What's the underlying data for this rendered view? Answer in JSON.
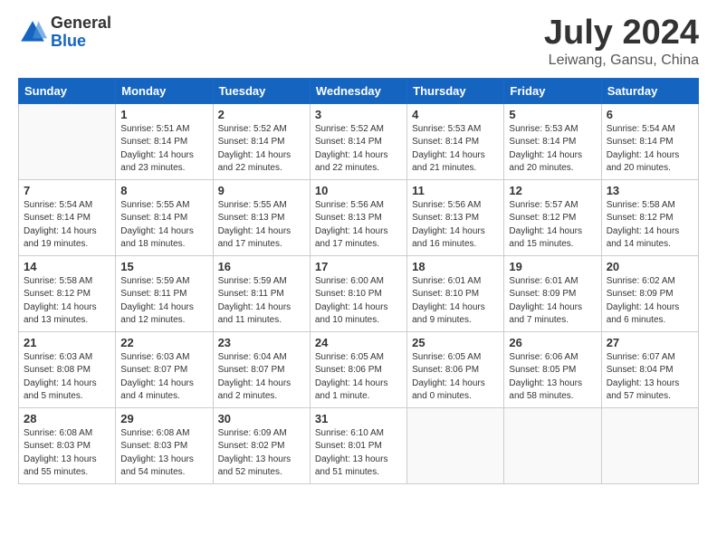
{
  "header": {
    "logo_general": "General",
    "logo_blue": "Blue",
    "month": "July 2024",
    "location": "Leiwang, Gansu, China"
  },
  "weekdays": [
    "Sunday",
    "Monday",
    "Tuesday",
    "Wednesday",
    "Thursday",
    "Friday",
    "Saturday"
  ],
  "weeks": [
    [
      {
        "day": "",
        "info": ""
      },
      {
        "day": "1",
        "info": "Sunrise: 5:51 AM\nSunset: 8:14 PM\nDaylight: 14 hours\nand 23 minutes."
      },
      {
        "day": "2",
        "info": "Sunrise: 5:52 AM\nSunset: 8:14 PM\nDaylight: 14 hours\nand 22 minutes."
      },
      {
        "day": "3",
        "info": "Sunrise: 5:52 AM\nSunset: 8:14 PM\nDaylight: 14 hours\nand 22 minutes."
      },
      {
        "day": "4",
        "info": "Sunrise: 5:53 AM\nSunset: 8:14 PM\nDaylight: 14 hours\nand 21 minutes."
      },
      {
        "day": "5",
        "info": "Sunrise: 5:53 AM\nSunset: 8:14 PM\nDaylight: 14 hours\nand 20 minutes."
      },
      {
        "day": "6",
        "info": "Sunrise: 5:54 AM\nSunset: 8:14 PM\nDaylight: 14 hours\nand 20 minutes."
      }
    ],
    [
      {
        "day": "7",
        "info": "Sunrise: 5:54 AM\nSunset: 8:14 PM\nDaylight: 14 hours\nand 19 minutes."
      },
      {
        "day": "8",
        "info": "Sunrise: 5:55 AM\nSunset: 8:14 PM\nDaylight: 14 hours\nand 18 minutes."
      },
      {
        "day": "9",
        "info": "Sunrise: 5:55 AM\nSunset: 8:13 PM\nDaylight: 14 hours\nand 17 minutes."
      },
      {
        "day": "10",
        "info": "Sunrise: 5:56 AM\nSunset: 8:13 PM\nDaylight: 14 hours\nand 17 minutes."
      },
      {
        "day": "11",
        "info": "Sunrise: 5:56 AM\nSunset: 8:13 PM\nDaylight: 14 hours\nand 16 minutes."
      },
      {
        "day": "12",
        "info": "Sunrise: 5:57 AM\nSunset: 8:12 PM\nDaylight: 14 hours\nand 15 minutes."
      },
      {
        "day": "13",
        "info": "Sunrise: 5:58 AM\nSunset: 8:12 PM\nDaylight: 14 hours\nand 14 minutes."
      }
    ],
    [
      {
        "day": "14",
        "info": "Sunrise: 5:58 AM\nSunset: 8:12 PM\nDaylight: 14 hours\nand 13 minutes."
      },
      {
        "day": "15",
        "info": "Sunrise: 5:59 AM\nSunset: 8:11 PM\nDaylight: 14 hours\nand 12 minutes."
      },
      {
        "day": "16",
        "info": "Sunrise: 5:59 AM\nSunset: 8:11 PM\nDaylight: 14 hours\nand 11 minutes."
      },
      {
        "day": "17",
        "info": "Sunrise: 6:00 AM\nSunset: 8:10 PM\nDaylight: 14 hours\nand 10 minutes."
      },
      {
        "day": "18",
        "info": "Sunrise: 6:01 AM\nSunset: 8:10 PM\nDaylight: 14 hours\nand 9 minutes."
      },
      {
        "day": "19",
        "info": "Sunrise: 6:01 AM\nSunset: 8:09 PM\nDaylight: 14 hours\nand 7 minutes."
      },
      {
        "day": "20",
        "info": "Sunrise: 6:02 AM\nSunset: 8:09 PM\nDaylight: 14 hours\nand 6 minutes."
      }
    ],
    [
      {
        "day": "21",
        "info": "Sunrise: 6:03 AM\nSunset: 8:08 PM\nDaylight: 14 hours\nand 5 minutes."
      },
      {
        "day": "22",
        "info": "Sunrise: 6:03 AM\nSunset: 8:07 PM\nDaylight: 14 hours\nand 4 minutes."
      },
      {
        "day": "23",
        "info": "Sunrise: 6:04 AM\nSunset: 8:07 PM\nDaylight: 14 hours\nand 2 minutes."
      },
      {
        "day": "24",
        "info": "Sunrise: 6:05 AM\nSunset: 8:06 PM\nDaylight: 14 hours\nand 1 minute."
      },
      {
        "day": "25",
        "info": "Sunrise: 6:05 AM\nSunset: 8:06 PM\nDaylight: 14 hours\nand 0 minutes."
      },
      {
        "day": "26",
        "info": "Sunrise: 6:06 AM\nSunset: 8:05 PM\nDaylight: 13 hours\nand 58 minutes."
      },
      {
        "day": "27",
        "info": "Sunrise: 6:07 AM\nSunset: 8:04 PM\nDaylight: 13 hours\nand 57 minutes."
      }
    ],
    [
      {
        "day": "28",
        "info": "Sunrise: 6:08 AM\nSunset: 8:03 PM\nDaylight: 13 hours\nand 55 minutes."
      },
      {
        "day": "29",
        "info": "Sunrise: 6:08 AM\nSunset: 8:03 PM\nDaylight: 13 hours\nand 54 minutes."
      },
      {
        "day": "30",
        "info": "Sunrise: 6:09 AM\nSunset: 8:02 PM\nDaylight: 13 hours\nand 52 minutes."
      },
      {
        "day": "31",
        "info": "Sunrise: 6:10 AM\nSunset: 8:01 PM\nDaylight: 13 hours\nand 51 minutes."
      },
      {
        "day": "",
        "info": ""
      },
      {
        "day": "",
        "info": ""
      },
      {
        "day": "",
        "info": ""
      }
    ]
  ]
}
